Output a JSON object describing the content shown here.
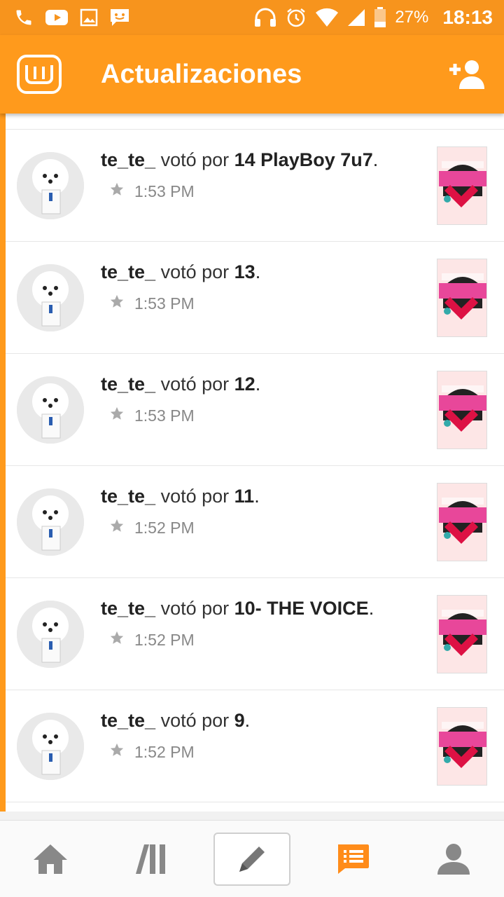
{
  "status_bar": {
    "battery_percent": "27%",
    "time": "18:13",
    "icons_left": [
      "phone-icon",
      "youtube-icon",
      "image-icon",
      "chat-icon"
    ],
    "icons_right": [
      "headphones-icon",
      "alarm-icon",
      "wifi-icon",
      "signal-icon",
      "battery-icon"
    ],
    "color": "#f7941d"
  },
  "header": {
    "title": "Actualizaciones",
    "logo_icon": "wattpad-logo-icon",
    "action_icon": "add-user-icon",
    "color": "#ff9a1c"
  },
  "feed": {
    "items": [
      {
        "user": "te_te_",
        "verb": "votó por",
        "story": "14 PlayBoy 7u7",
        "end": ".",
        "time": "1:53 PM"
      },
      {
        "user": "te_te_",
        "verb": "votó por",
        "story": "13",
        "end": ".",
        "time": "1:53 PM"
      },
      {
        "user": "te_te_",
        "verb": "votó por",
        "story": "12",
        "end": ".",
        "time": "1:53 PM"
      },
      {
        "user": "te_te_",
        "verb": "votó por",
        "story": "11",
        "end": ".",
        "time": "1:52 PM"
      },
      {
        "user": "te_te_",
        "verb": "votó por",
        "story": "10- THE VOICE",
        "end": ".",
        "time": "1:52 PM"
      },
      {
        "user": "te_te_",
        "verb": "votó por",
        "story": "9",
        "end": ".",
        "time": "1:52 PM"
      }
    ]
  },
  "bottom_nav": {
    "items": [
      "home-icon",
      "library-icon",
      "write-icon",
      "updates-icon",
      "profile-icon"
    ],
    "active": "updates-icon",
    "active_color": "#ff8c1a",
    "inactive_color": "#888888"
  }
}
